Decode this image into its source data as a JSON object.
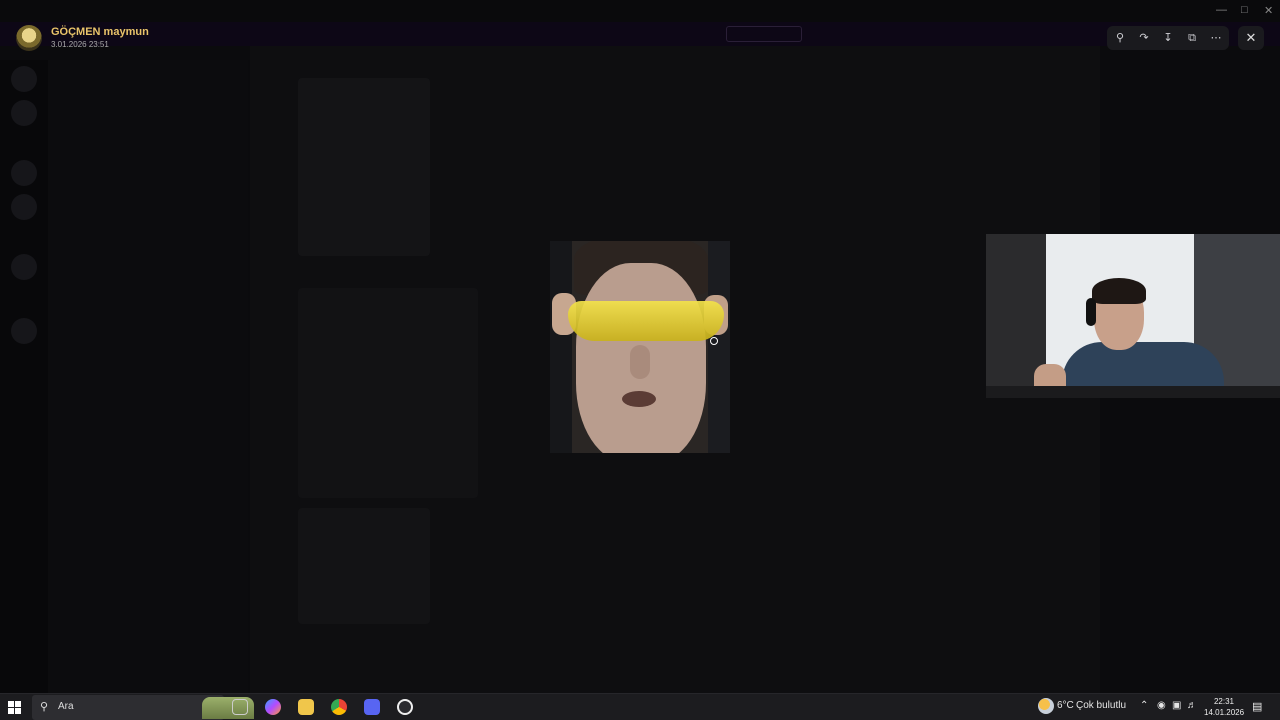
{
  "viewer": {
    "author": "GÖÇMEN maymun",
    "timestamp": "3.01.2026 23:51",
    "tools": {
      "zoom_icon": "zoom-icon",
      "forward_icon": "forward-icon",
      "download_icon": "download-icon",
      "open_external_icon": "open-external-icon",
      "more_icon": "more-icon",
      "close_icon": "close-icon"
    }
  },
  "taskbar": {
    "search_placeholder": "Ara",
    "weather_temp": "6°C",
    "weather_desc": "Çok bulutlu",
    "time": "22:31",
    "date": "14.01.2026"
  },
  "colors": {
    "author_name": "#e9c46a",
    "viewer_toolbar": "#1a1a1e",
    "taskbar": "#1c1c1f"
  }
}
